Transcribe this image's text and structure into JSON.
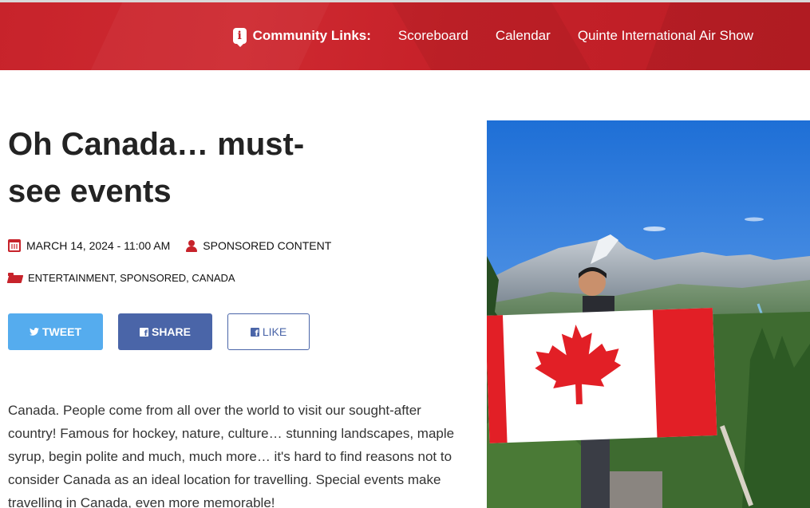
{
  "header": {
    "community_links_label": "Community Links:",
    "links": [
      "Scoreboard",
      "Calendar",
      "Quinte International Air Show"
    ],
    "info_icon": "i",
    "accent_color": "#c7232b"
  },
  "article": {
    "title": "Oh Canada… must-see events",
    "date": "MARCH 14, 2024 - 11:00 AM",
    "author": "SPONSORED CONTENT",
    "categories": "ENTERTAINMENT, SPONSORED, CANADA",
    "body": "Canada. People come from all over the world to visit our sought-after country! Famous for hockey, nature, culture… stunning landscapes, maple syrup, begin polite and much, much more… it's hard to find reasons not to consider Canada as an ideal location for travelling. Special events make travelling in Canada, even more memorable!"
  },
  "share": {
    "tweet_label": "TWEET",
    "share_label": "SHARE",
    "like_label": "LIKE",
    "tweet_color": "#55acee",
    "facebook_color": "#4a65a8"
  }
}
